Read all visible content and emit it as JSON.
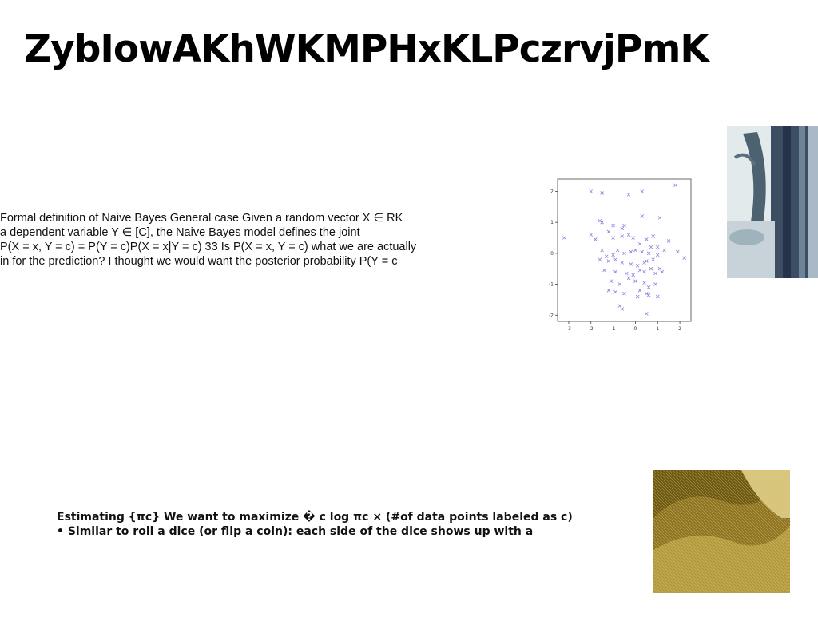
{
  "slide": {
    "title": "ZybIowAKhWKMPHxKLPczrvjPmK"
  },
  "paragraph_top": {
    "lines": [
      "Formal definition of Naive Bayes General case Given a random vector X ∈ RK",
      "a dependent variable Y ∈ [C], the Naive Bayes model defines the joint",
      "P(X = x, Y = c) = P(Y = c)P(X = x|Y = c) 33 Is P(X = x, Y = c) what we are actually",
      "in for the prediction? I thought we would want the posterior probability P(Y = c"
    ]
  },
  "paragraph_bottom": {
    "lines": [
      "Estimating {πc} We want to maximize � c log πc × (#of data points labeled as c)",
      "• Similar to roll a dice (or flip a coin): each side of the dice shows up with a"
    ]
  },
  "chart_data": {
    "type": "scatter",
    "marker": "x",
    "color": "#8a7fe0",
    "xlim": [
      -3.5,
      2.5
    ],
    "ylim": [
      -2.2,
      2.4
    ],
    "xticks": [
      "-3",
      "-2",
      "-1",
      "0",
      "1",
      "2"
    ],
    "yticks": [
      "-2",
      "-1",
      "0",
      "1",
      "2"
    ],
    "x": [
      -3.2,
      -2.0,
      -1.5,
      -0.3,
      0.3,
      1.8,
      -1.6,
      -1.5,
      -1.0,
      -0.6,
      -0.5,
      0.3,
      1.1,
      -2.0,
      -1.8,
      -1.2,
      -1.0,
      -0.6,
      -0.3,
      -0.1,
      0.2,
      0.5,
      0.8,
      1.0,
      1.5,
      -1.5,
      -1.3,
      -1.0,
      -0.8,
      -0.5,
      -0.2,
      0.0,
      0.3,
      0.6,
      0.7,
      1.0,
      1.3,
      1.9,
      2.2,
      -1.6,
      -1.2,
      -0.9,
      -0.6,
      -0.2,
      0.1,
      0.4,
      0.5,
      0.8,
      1.1,
      -1.4,
      -0.9,
      -0.4,
      -0.1,
      0.2,
      0.4,
      0.7,
      0.9,
      1.2,
      -1.1,
      -0.7,
      -0.3,
      0.0,
      0.4,
      0.6,
      0.9,
      -1.2,
      -0.9,
      -0.5,
      0.2,
      0.5,
      -0.7,
      -0.6,
      0.6,
      1.0,
      0.1,
      0.5
    ],
    "y": [
      0.5,
      2.0,
      1.95,
      1.9,
      2.0,
      2.2,
      1.05,
      1.0,
      0.9,
      0.8,
      0.9,
      1.2,
      1.15,
      0.6,
      0.45,
      0.7,
      0.5,
      0.55,
      0.6,
      0.5,
      0.3,
      0.45,
      0.55,
      0.2,
      0.4,
      0.1,
      -0.1,
      -0.05,
      0.1,
      0.0,
      0.05,
      0.1,
      0.05,
      0.0,
      0.2,
      -0.05,
      0.1,
      0.05,
      -0.15,
      -0.2,
      -0.25,
      -0.2,
      -0.3,
      -0.35,
      -0.4,
      -0.3,
      -0.25,
      -0.2,
      -0.5,
      -0.55,
      -0.6,
      -0.65,
      -0.7,
      -0.55,
      -0.6,
      -0.5,
      -0.65,
      -0.6,
      -0.9,
      -1.0,
      -0.8,
      -0.9,
      -0.95,
      -1.1,
      -1.0,
      -1.2,
      -1.25,
      -1.3,
      -1.2,
      -1.3,
      -1.7,
      -1.8,
      -1.35,
      -1.4,
      -1.4,
      -1.95
    ]
  },
  "images": {
    "photo_top_right": "vase-photo",
    "photo_bottom_right": "golden-terrain-photo"
  }
}
